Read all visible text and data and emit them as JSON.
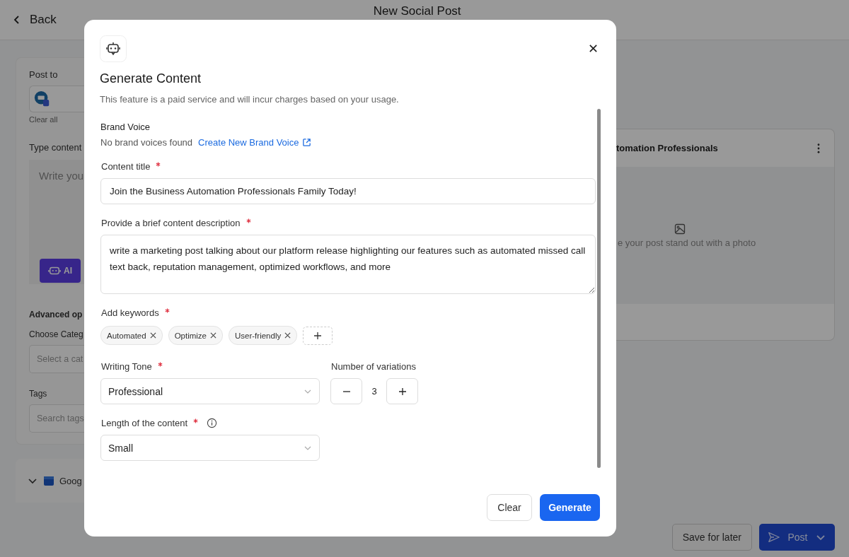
{
  "header": {
    "back": "Back",
    "title": "New Social Post"
  },
  "composer": {
    "post_to_label": "Post to",
    "clear_all": "Clear all",
    "type_content_label": "Type content",
    "content_placeholder": "Write you",
    "ai_button": "AI",
    "advanced_heading": "Advanced op",
    "category_label": "Choose Categ",
    "category_placeholder": "Select a cat",
    "tags_label": "Tags",
    "tags_placeholder": "Search tags",
    "account_row": "Goog"
  },
  "preview": {
    "title": "tomation Professionals",
    "photo_hint": "e your post stand out with a photo"
  },
  "footer": {
    "save": "Save for later",
    "post": "Post"
  },
  "modal": {
    "title": "Generate Content",
    "notice": "This feature is a paid service and will incur charges based on your usage.",
    "brand_voice": {
      "label": "Brand Voice",
      "empty": "No brand voices found",
      "link": "Create New Brand Voice"
    },
    "content_title": {
      "label": "Content title",
      "required": true,
      "value": "Join the Business Automation Professionals Family Today!"
    },
    "description": {
      "label": "Provide a brief content description",
      "required": true,
      "value": "write a marketing post talking about our platform release highlighting our features such as automated missed call text back, reputation management, optimized workflows, and more"
    },
    "keywords": {
      "label": "Add keywords",
      "required": true,
      "items": [
        "Automated",
        "Optimize",
        "User-friendly"
      ]
    },
    "writing_tone": {
      "label": "Writing Tone",
      "required": true,
      "value": "Professional"
    },
    "variations": {
      "label": "Number of variations",
      "value": "3"
    },
    "length": {
      "label": "Length of the content",
      "required": true,
      "value": "Small"
    },
    "buttons": {
      "clear": "Clear",
      "generate": "Generate"
    }
  }
}
